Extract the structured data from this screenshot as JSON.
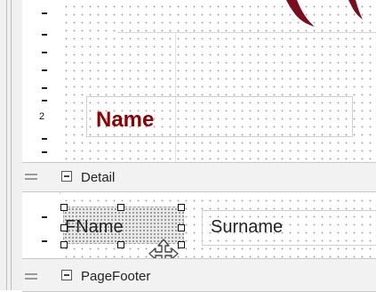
{
  "ruler": {
    "label_2": "2"
  },
  "page_header": {
    "name_label": "Name"
  },
  "detail_band": {
    "title": "Detail"
  },
  "detail_fields": {
    "fname": "FName",
    "surname": "Surname"
  },
  "page_footer_band": {
    "title": "PageFooter"
  },
  "colors": {
    "accent": "#8b0000",
    "band_bg": "#f2f2f2"
  },
  "icons": [
    "collapse-detail-icon",
    "collapse-pagefooter-icon",
    "move-cursor-icon",
    "band-grip-icon"
  ]
}
